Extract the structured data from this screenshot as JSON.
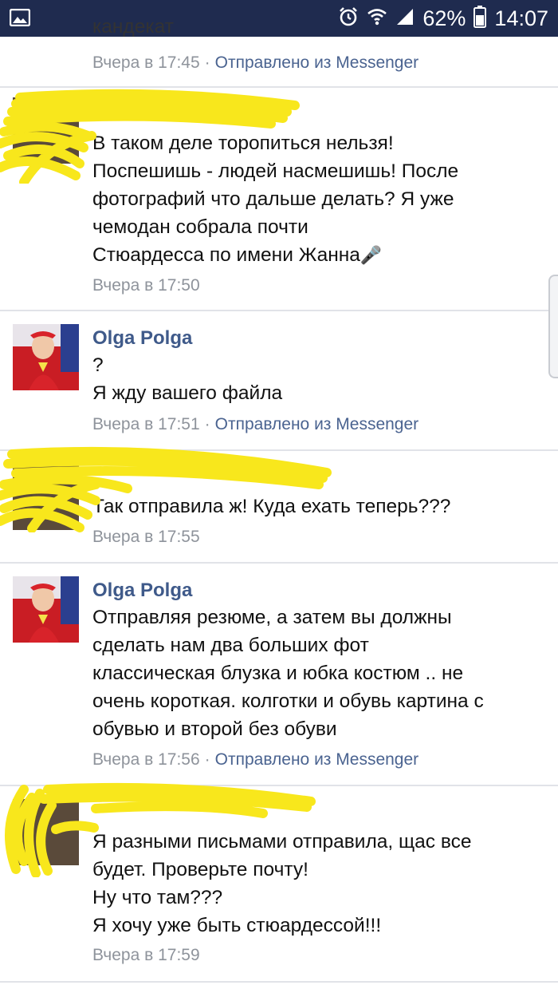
{
  "status_bar": {
    "battery": "62%",
    "time": "14:07"
  },
  "messages": [
    {
      "truncated_text": "кандекат",
      "time": "Вчера в 17:45",
      "separator": "·",
      "source": "Отправлено из Messenger"
    },
    {
      "lines": [
        "В таком деле торопиться нельзя!",
        "Поспешишь - людей насмешишь! После",
        "фотографий что дальше делать? Я уже",
        "чемодан собрала почти",
        "Стюардесса по имени Жанна"
      ],
      "emoji": "🎤",
      "time": "Вчера в 17:50"
    },
    {
      "sender": "Olga Polga",
      "lines": [
        "?",
        "Я жду вашего файла"
      ],
      "time": "Вчера в 17:51",
      "separator": "·",
      "source": "Отправлено из Messenger"
    },
    {
      "lines": [
        "Так отправила ж! Куда ехать теперь???"
      ],
      "time": "Вчера в 17:55"
    },
    {
      "sender": "Olga Polga",
      "lines": [
        "Отправляя резюме, а затем вы должны",
        "сделать нам два больших фот",
        "классическая блузка и юбка костюм .. не",
        "очень короткая. колготки и обувь картина с",
        "обувью и второй без обуви"
      ],
      "time": "Вчера в 17:56",
      "separator": "·",
      "source": "Отправлено из Messenger"
    },
    {
      "lines": [
        "Я разными письмами отправила, щас все",
        "будет. Проверьте почту!",
        "Ну что там???",
        "Я хочу уже быть стюардессой!!!"
      ],
      "time": "Вчера в 17:59"
    }
  ],
  "colors": {
    "status_bar_bg": "#1f2b4f",
    "sender_name": "#3f5a8a",
    "meta_text": "#8e939b",
    "source_link": "#4a6390",
    "scribble": "#f8e71c"
  }
}
